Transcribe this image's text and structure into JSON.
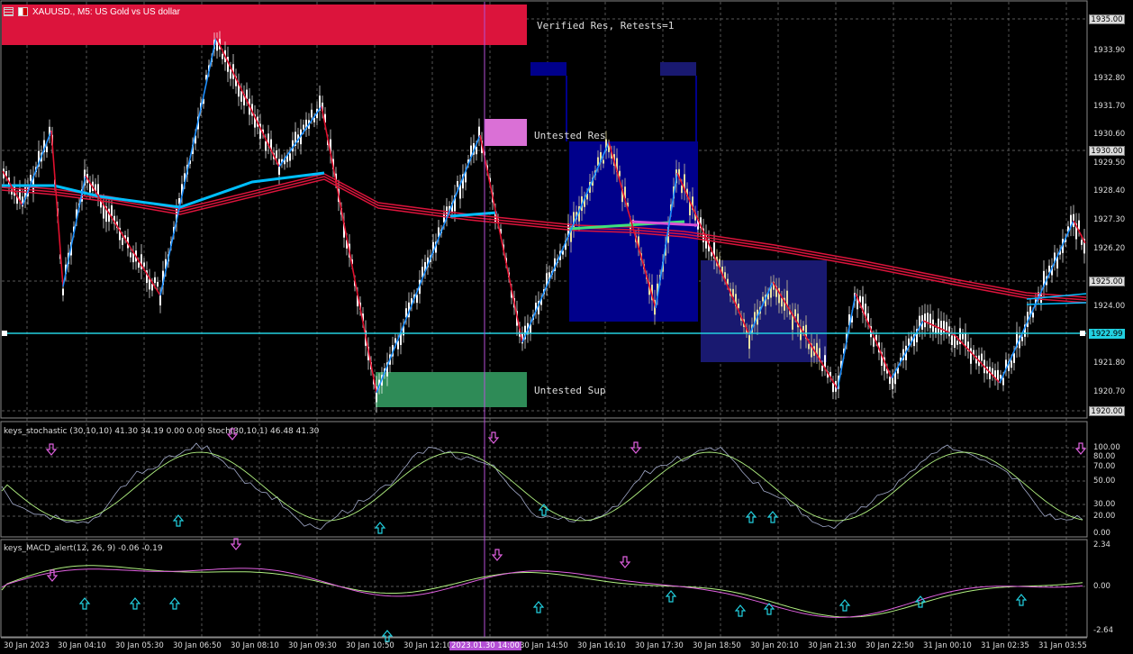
{
  "window": {
    "symbol_title": "XAUUSD., M5: US Gold vs US dollar",
    "icon_left": "chart-grid-icon",
    "icon_right": "flag-icon"
  },
  "zones": {
    "verified_res": "Verified Res, Retests=1",
    "untested_res": "Untested Res",
    "untested_sup": "Untested Sup"
  },
  "price_axis": {
    "labels": [
      "1933.90",
      "1932.80",
      "1931.70",
      "1930.60",
      "1929.50",
      "1928.40",
      "1927.30",
      "1926.20",
      "1924.00",
      "1921.80",
      "1920.70"
    ],
    "tag_1935": "1935.00",
    "tag_1930": "1930.00",
    "tag_1925": "1925.00",
    "tag_current": "1922.99",
    "tag_1920": "1920.00"
  },
  "stoch": {
    "label": "keys_stochastic (30,10,10) 41.30 34.19 0.00 0.00 Stoch(30,10,1) 46.48 41.30",
    "levels": [
      "100.00",
      "80.00",
      "70.00",
      "50.00",
      "30.00",
      "20.00",
      "0.00"
    ]
  },
  "macd": {
    "label": "keys_MACD_alert(12, 26, 9) -0.06 -0.19",
    "levels": [
      "2.34",
      "0.00",
      "-2.64"
    ]
  },
  "time_axis": {
    "labels": [
      "30 Jan 2023",
      "30 Jan 04:10",
      "30 Jan 05:30",
      "30 Jan 06:50",
      "30 Jan 08:10",
      "30 Jan 09:30",
      "30 Jan 10:50",
      "30 Jan 12:10",
      "2023.01.30 14:00",
      "30 Jan 14:50",
      "30 Jan 16:10",
      "30 Jan 17:30",
      "30 Jan 18:50",
      "30 Jan 20:10",
      "30 Jan 21:30",
      "30 Jan 22:50",
      "31 Jan 00:10",
      "31 Jan 02:35",
      "31 Jan 03:55"
    ],
    "highlight_index": 8
  },
  "colors": {
    "res_zone": "#dc143c",
    "res_zone2": "#da70d6",
    "sup_zone": "#2e8b57",
    "blue_zone": "#00008b",
    "blue_zone2": "#191970",
    "zigzag_up": "#1e90ff",
    "zigzag_dn": "#e0102e",
    "ma_red": "#dc143c",
    "ma_cyan": "#00bfff",
    "current_line": "#22d0e0",
    "crosshair": "#b44fd4"
  }
}
